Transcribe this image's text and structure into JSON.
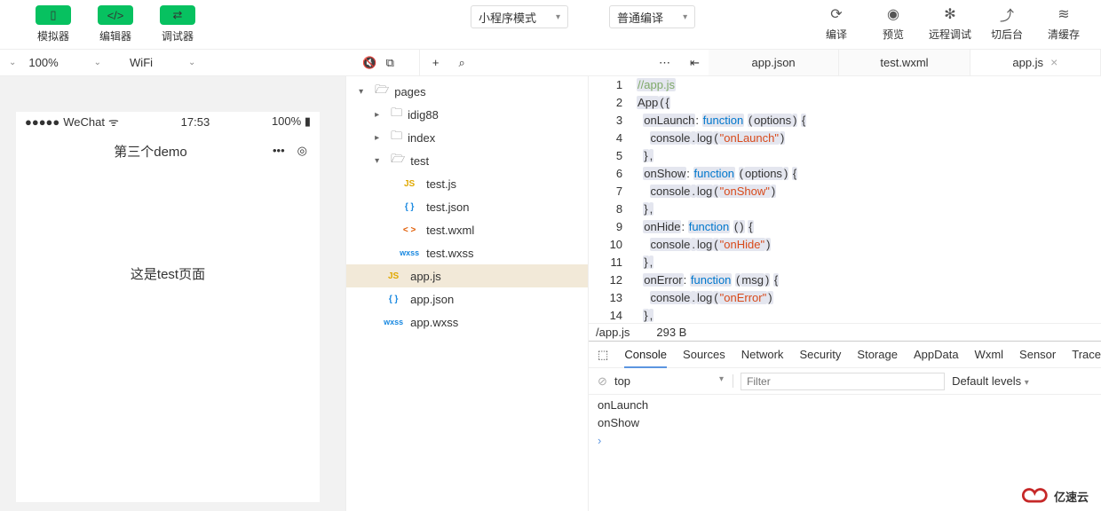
{
  "topbar": {
    "simulator_label": "模拟器",
    "editor_label": "编辑器",
    "debugger_label": "调试器",
    "mode_select": "小程序模式",
    "compile_select": "普通编译",
    "compile": "编译",
    "preview": "预览",
    "remote_debug": "远程调试",
    "background": "切后台",
    "clear_cache": "清缓存"
  },
  "subbar": {
    "zoom": "100%",
    "network": "WiFi"
  },
  "simulator": {
    "signal_label": "WeChat",
    "time": "17:53",
    "battery": "100%",
    "title": "第三个demo",
    "body_text": "这是test页面"
  },
  "tree": {
    "root": "pages",
    "children": [
      "idig88",
      "index",
      "test"
    ],
    "test_files": [
      "test.js",
      "test.json",
      "test.wxml",
      "test.wxss"
    ],
    "root_files": [
      "app.js",
      "app.json",
      "app.wxss"
    ]
  },
  "editor": {
    "tabs": [
      "app.json",
      "test.wxml",
      "app.js"
    ],
    "active_file": "/app.js",
    "file_size": "293 B",
    "code": [
      {
        "n": 1,
        "html": "<span class='hl cmt'>//app.js</span>"
      },
      {
        "n": 2,
        "html": "<span class='hl'>App</span><span class='hl'>(</span><span class='hl'>{</span>"
      },
      {
        "n": 3,
        "html": "  <span class='hl'>onLaunch</span>: <span class='hl kw'>function</span> <span class='hl'>(</span><span class='hl'>options</span><span class='hl'>)</span> <span class='hl'>{</span>"
      },
      {
        "n": 4,
        "html": "    <span class='hl'>console</span><span class='hl'>.</span><span class='hl'>log</span><span class='hl'>(</span><span class='hl str'>\"onLaunch\"</span><span class='hl'>)</span>"
      },
      {
        "n": 5,
        "html": "  <span class='hl'>}</span><span class='hl'>,</span>"
      },
      {
        "n": 6,
        "html": "  <span class='hl'>onShow</span>: <span class='hl kw'>function</span> <span class='hl'>(</span><span class='hl'>options</span><span class='hl'>)</span> <span class='hl'>{</span>"
      },
      {
        "n": 7,
        "html": "    <span class='hl'>console</span><span class='hl'>.</span><span class='hl'>log</span><span class='hl'>(</span><span class='hl str'>\"onShow\"</span><span class='hl'>)</span>"
      },
      {
        "n": 8,
        "html": "  <span class='hl'>}</span><span class='hl'>,</span>"
      },
      {
        "n": 9,
        "html": "  <span class='hl'>onHide</span>: <span class='hl kw'>function</span> <span class='hl'>(</span><span class='hl'>)</span> <span class='hl'>{</span>"
      },
      {
        "n": 10,
        "html": "    <span class='hl'>console</span><span class='hl'>.</span><span class='hl'>log</span><span class='hl'>(</span><span class='hl str'>\"onHide\"</span><span class='hl'>)</span>"
      },
      {
        "n": 11,
        "html": "  <span class='hl'>}</span><span class='hl'>,</span>"
      },
      {
        "n": 12,
        "html": "  <span class='hl'>onError</span>: <span class='hl kw'>function</span> <span class='hl'>(</span><span class='hl'>msg</span><span class='hl'>)</span> <span class='hl'>{</span>"
      },
      {
        "n": 13,
        "html": "    <span class='hl'>console</span><span class='hl'>.</span><span class='hl'>log</span><span class='hl'>(</span><span class='hl str'>\"onError\"</span><span class='hl'>)</span>"
      },
      {
        "n": 14,
        "html": "  <span class='hl'>}</span><span class='hl'>,</span>"
      }
    ]
  },
  "devtools": {
    "tabs": [
      "Console",
      "Sources",
      "Network",
      "Security",
      "Storage",
      "AppData",
      "Wxml",
      "Sensor",
      "Trace"
    ],
    "context": "top",
    "filter_placeholder": "Filter",
    "levels": "Default levels",
    "console_lines": [
      "onLaunch",
      "onShow"
    ]
  },
  "logo_text": "亿速云"
}
